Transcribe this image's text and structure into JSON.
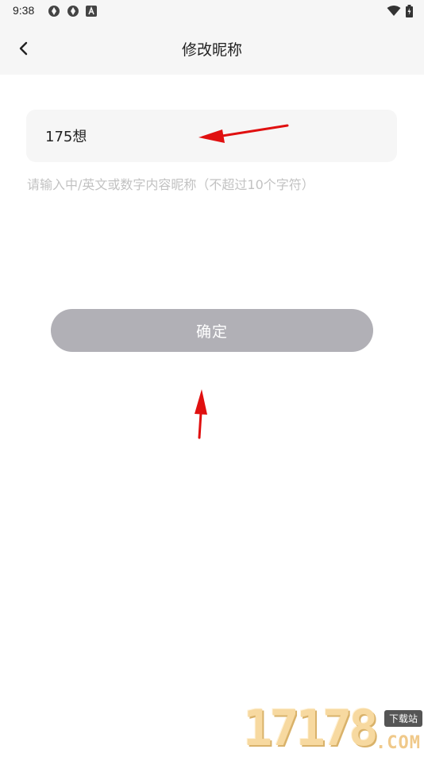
{
  "status_bar": {
    "time": "9:38"
  },
  "header": {
    "title": "修改昵称",
    "back_icon": "chevron-left-icon"
  },
  "form": {
    "nickname_value": "175想",
    "hint": "请输入中/英文或数字内容昵称（不超过10个字符）",
    "confirm_label": "确定"
  },
  "watermark": {
    "digits": "17178",
    "tag": "下载站",
    "suffix": ".COM"
  },
  "colors": {
    "header_bg": "#f6f6f6",
    "field_bg": "#f6f6f6",
    "hint_text": "#c2c2c2",
    "button_bg": "#b1b0b6",
    "button_text": "#ffffff",
    "annotation_arrow": "#e01010"
  }
}
